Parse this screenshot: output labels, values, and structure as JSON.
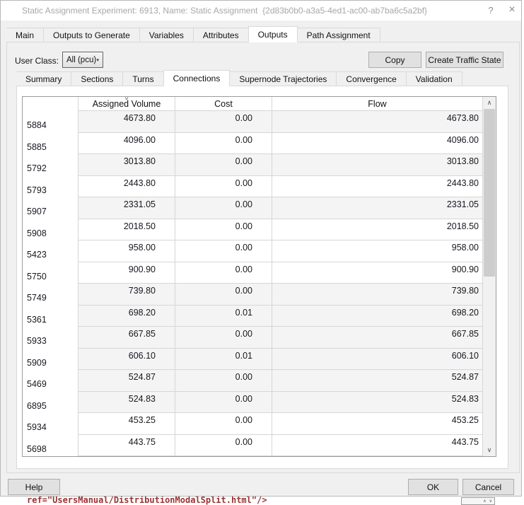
{
  "window": {
    "title": "Static Assignment Experiment: 6913, Name: Static Assignment  {2d83b0b0-a3a5-4ed1-ac00-ab7ba6c5a2bf}",
    "help_glyph": "?",
    "close_glyph": "×"
  },
  "main_tabs": [
    {
      "label": "Main"
    },
    {
      "label": "Outputs to Generate"
    },
    {
      "label": "Variables"
    },
    {
      "label": "Attributes"
    },
    {
      "label": "Outputs",
      "active": true
    },
    {
      "label": "Path Assignment"
    }
  ],
  "toolbar": {
    "user_class_label": "User Class:",
    "user_class_value": "All (pcu)",
    "dropdown_arrow": "▾",
    "copy_label": "Copy",
    "create_traffic_state_label": "Create Traffic State"
  },
  "sub_tabs": [
    {
      "label": "Summary"
    },
    {
      "label": "Sections"
    },
    {
      "label": "Turns"
    },
    {
      "label": "Connections",
      "active": true
    },
    {
      "label": "Supernode Trajectories"
    },
    {
      "label": "Convergence"
    },
    {
      "label": "Validation"
    }
  ],
  "table": {
    "columns": {
      "assigned_volume": "Assigned Volume",
      "cost": "Cost",
      "flow": "Flow"
    },
    "sort_indicator": "∨",
    "rows": [
      {
        "id": "5884",
        "assigned_volume": "4673.80",
        "cost": "0.00",
        "flow": "4673.80",
        "shaded": true
      },
      {
        "id": "5885",
        "assigned_volume": "4096.00",
        "cost": "0.00",
        "flow": "4096.00",
        "shaded": false
      },
      {
        "id": "5792",
        "assigned_volume": "3013.80",
        "cost": "0.00",
        "flow": "3013.80",
        "shaded": true
      },
      {
        "id": "5793",
        "assigned_volume": "2443.80",
        "cost": "0.00",
        "flow": "2443.80",
        "shaded": false
      },
      {
        "id": "5907",
        "assigned_volume": "2331.05",
        "cost": "0.00",
        "flow": "2331.05",
        "shaded": true
      },
      {
        "id": "5908",
        "assigned_volume": "2018.50",
        "cost": "0.00",
        "flow": "2018.50",
        "shaded": false
      },
      {
        "id": "5423",
        "assigned_volume": "958.00",
        "cost": "0.00",
        "flow": "958.00",
        "shaded": false
      },
      {
        "id": "5750",
        "assigned_volume": "900.90",
        "cost": "0.00",
        "flow": "900.90",
        "shaded": false
      },
      {
        "id": "5749",
        "assigned_volume": "739.80",
        "cost": "0.00",
        "flow": "739.80",
        "shaded": true
      },
      {
        "id": "5361",
        "assigned_volume": "698.20",
        "cost": "0.01",
        "flow": "698.20",
        "shaded": true
      },
      {
        "id": "5933",
        "assigned_volume": "667.85",
        "cost": "0.00",
        "flow": "667.85",
        "shaded": true
      },
      {
        "id": "5909",
        "assigned_volume": "606.10",
        "cost": "0.01",
        "flow": "606.10",
        "shaded": true
      },
      {
        "id": "5469",
        "assigned_volume": "524.87",
        "cost": "0.00",
        "flow": "524.87",
        "shaded": true
      },
      {
        "id": "6895",
        "assigned_volume": "524.83",
        "cost": "0.00",
        "flow": "524.83",
        "shaded": true
      },
      {
        "id": "5934",
        "assigned_volume": "453.25",
        "cost": "0.00",
        "flow": "453.25",
        "shaded": false
      },
      {
        "id": "5698",
        "assigned_volume": "443.75",
        "cost": "0.00",
        "flow": "443.75",
        "shaded": false
      }
    ]
  },
  "scrollbar": {
    "up_glyph": "∧",
    "down_glyph": "∨"
  },
  "footer": {
    "help_label": "Help",
    "ok_label": "OK",
    "cancel_label": "Cancel"
  },
  "background": {
    "code_text": "ref=\"UsersManual/DistributionModalSplit.html\"/>"
  },
  "colors": {
    "shaded_row": "#f4f4f4",
    "code_text": "#9c3232",
    "titlebar_bg": "#ffffff",
    "dialog_bg": "#f0f0f0"
  }
}
